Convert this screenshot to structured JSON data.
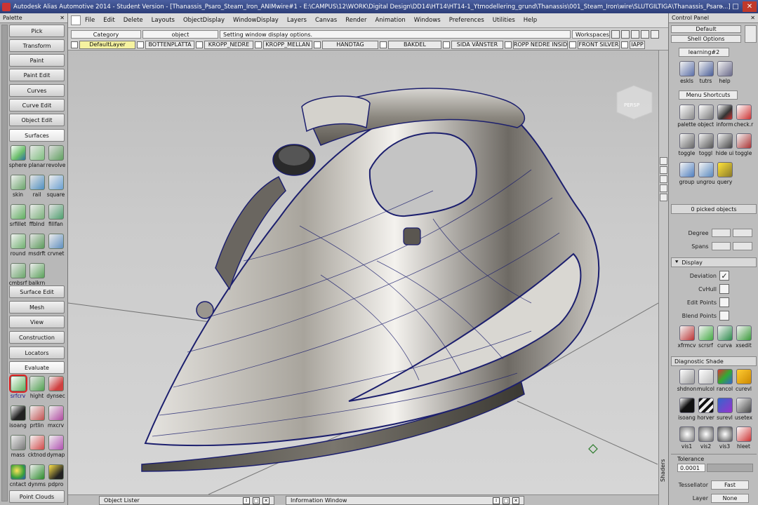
{
  "title_bar": {
    "text": "Autodesk Alias Automotive 2014 - Student Version - [Thanassis_Psaro_Steam_Iron_ANIMwire#1 - E:\\CAMPUS\\12\\WORK\\Digital Design\\DD14\\HT14\\HT14-1_Ytmodellering_grund\\Thanassis\\001_Steam_Iron\\wire\\SLUTGILTIGA\\Thanassis_Psaro...]",
    "minimize": "–",
    "maximize": "□",
    "close": "✕"
  },
  "palette": {
    "title": "Palette",
    "close": "✕",
    "buttons": [
      "Pick",
      "Transform",
      "Paint",
      "Paint Edit",
      "Curves",
      "Curve Edit",
      "Object Edit",
      "Surfaces",
      "Surface Edit",
      "Mesh",
      "View",
      "Construction",
      "Locators",
      "Evaluate",
      "Point Clouds"
    ],
    "surfaces_tools": [
      "sphere",
      "planar",
      "revolve",
      "skin",
      "rail",
      "square",
      "srfillet",
      "ffblnd",
      "fillfan",
      "round",
      "msdrft",
      "crvnet",
      "cmbsrf",
      "balkrn"
    ],
    "evaluate_tools": [
      "srfcrv",
      "hight",
      "dynsec",
      "isoang",
      "prtlin",
      "mxcrv",
      "mass",
      "cktnod",
      "dymap",
      "cntact",
      "dynms",
      "pdpro"
    ]
  },
  "menubar": {
    "items": [
      "File",
      "Edit",
      "Delete",
      "Layouts",
      "ObjectDisplay",
      "WindowDisplay",
      "Layers",
      "Canvas",
      "Render",
      "Animation",
      "Windows",
      "Preferences",
      "Utilities",
      "Help"
    ]
  },
  "toolbar": {
    "category_label": "Category",
    "object_label": "object",
    "message": "Setting window display options.",
    "workspaces_label": "Workspaces",
    "layers": [
      "DefaultLayer",
      "BOTTENPLATTA",
      "KROPP_NEDRE",
      "KROPP_MELLAN",
      "HANDTAG",
      "BAKDEL",
      "SIDA VÄNSTER",
      "ROPP NEDRE INSID",
      "FRONT SILVER",
      "IAPP"
    ]
  },
  "viewport": {
    "viewcube_label": "PERSP",
    "colors": {
      "wire": "#1c1f6e",
      "accent": "#2a7a2a"
    }
  },
  "bottom_bar": {
    "object_lister": "Object Lister",
    "information_window": "Information Window",
    "ctl_i": "I",
    "ctl_max": "□",
    "ctl_close": "✕"
  },
  "control_panel": {
    "title": "Control Panel",
    "close": "✕",
    "dropdown_default": "Default",
    "dropdown_shell": "Shell Options",
    "tab_learning": "learning#2",
    "learning_tools": [
      "eskls",
      "tutrs",
      "help"
    ],
    "tab_shortcuts": "Menu Shortcuts",
    "shortcut_tools": [
      "palette",
      "object",
      "inform",
      "check.r",
      "toggle",
      "toggl",
      "hide ui",
      "toggle",
      "group",
      "ungrou",
      "query"
    ],
    "picked_objects": "0 picked objects",
    "degree_label": "Degree",
    "spans_label": "Spans",
    "display_section": "Display",
    "display_rows": [
      "Deviation",
      "CvHull",
      "Edit Points",
      "Blend Points"
    ],
    "display_checks": [
      "✓",
      "",
      "",
      ""
    ],
    "display_tools": [
      "xfrmcv",
      "scrsrf",
      "curva",
      "xsedit"
    ],
    "diagnostic_section": "Diagnostic Shade",
    "diagnostic_tools": [
      "shdnon",
      "mulcol",
      "rancol",
      "curevl",
      "isoang",
      "horver",
      "surevl",
      "usetex",
      "vis1",
      "vis2",
      "vis3",
      "hleet"
    ],
    "tolerance_label": "Tolerance",
    "tolerance_value": "0.0001",
    "tessellator_label": "Tessellator",
    "tessellator_value": "Fast",
    "layer_label": "Layer",
    "layer_value": "None",
    "shaders_label": "Shaders"
  }
}
